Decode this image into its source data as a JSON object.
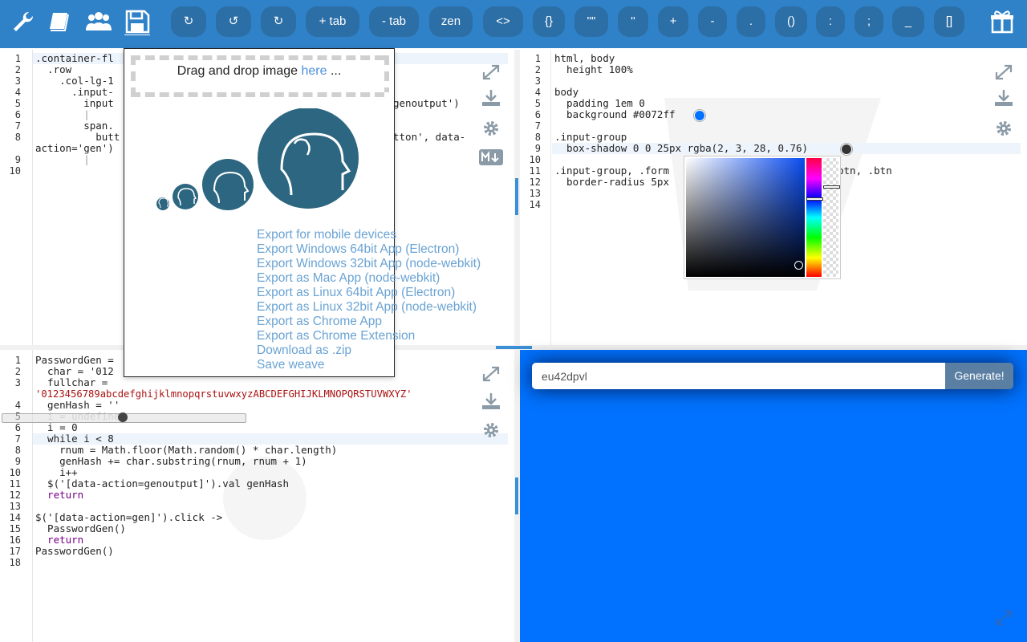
{
  "toolbar": {
    "buttons": [
      {
        "label": "↻",
        "name": "refresh-button"
      },
      {
        "label": "↺",
        "name": "undo-button"
      },
      {
        "label": "↻",
        "name": "redo-button"
      },
      {
        "label": "+ tab",
        "name": "add-tab-button"
      },
      {
        "label": "- tab",
        "name": "remove-tab-button"
      },
      {
        "label": "zen",
        "name": "zen-button"
      },
      {
        "label": "<>",
        "name": "insert-angle-brackets-button"
      },
      {
        "label": "{}",
        "name": "insert-braces-button"
      },
      {
        "label": "\"\"",
        "name": "insert-double-quotes-button"
      },
      {
        "label": "''",
        "name": "insert-single-quotes-button"
      },
      {
        "label": "+",
        "name": "insert-plus-button"
      },
      {
        "label": "-",
        "name": "insert-minus-button"
      },
      {
        "label": ".",
        "name": "insert-dot-button"
      },
      {
        "label": "()",
        "name": "insert-parens-button"
      },
      {
        "label": ":",
        "name": "insert-colon-button"
      },
      {
        "label": ";",
        "name": "insert-semicolon-button"
      },
      {
        "label": "_",
        "name": "insert-underscore-button"
      },
      {
        "label": "[]",
        "name": "insert-brackets-button"
      }
    ]
  },
  "popup": {
    "drop_text": "Drag and drop image ",
    "drop_link": "here",
    "drop_suffix": " ...",
    "exports": [
      "Export for mobile devices",
      "Export Windows 64bit App (Electron)",
      "Export Windows 32bit App (node-webkit)",
      "Export as Mac App (node-webkit)",
      "Export as Linux 64bit App (Electron)",
      "Export as Linux 32bit App (node-webkit)",
      "Export as Chrome App",
      "Export as Chrome Extension",
      "Download as .zip",
      "Save weave"
    ]
  },
  "html_pane": {
    "line_numbers": [
      "1",
      "2",
      "3",
      "4",
      "5",
      "6",
      "7",
      "8",
      "",
      "9",
      "10"
    ],
    "lines": [
      ".container-fl",
      "  .row",
      "    .col-lg-1",
      "      .input-",
      "        input",
      "        |",
      "        span.",
      "          butt",
      "action='gen')",
      "        |",
      ""
    ],
    "overflow_1": "genoutput')",
    "overflow_2": "tton', data-"
  },
  "css_pane": {
    "line_numbers": [
      "1",
      "2",
      "3",
      "4",
      "5",
      "6",
      "7",
      "8",
      "9",
      "10",
      "11",
      "12",
      "13",
      "14"
    ],
    "lines": [
      "html, body",
      "  height 100%",
      "",
      "body",
      "  padding 1em 0",
      "  background #0072ff",
      "",
      ".input-group",
      "  box-shadow 0 0 25px rgba(2, 3, 28, 0.76)",
      "",
      ".input-group, .form",
      "  border-radius 5px",
      "",
      ""
    ],
    "overflow_11": "btn, .btn",
    "colors": {
      "swatch_blue": "#0072ff",
      "swatch_dark": "#02031c"
    }
  },
  "js_pane": {
    "line_numbers": [
      "1",
      "2",
      "3",
      "",
      "4",
      "5",
      "6",
      "7",
      "8",
      "9",
      "10",
      "11",
      "12",
      "13",
      "14",
      "15",
      "16",
      "17",
      "18"
    ],
    "lines": [
      "PasswordGen =",
      "  char = '012",
      "  fullchar =",
      "'0123456789abcdefghijklmnopqrstuvwxyzABCDEFGHIJKLMNOPQRSTUVWXYZ'",
      "  genHash = ''",
      "  i = undefined",
      "  i = 0",
      "  while i < 8",
      "    rnum = Math.floor(Math.random() * char.length)",
      "    genHash += char.substring(rnum, rnum + 1)",
      "    i++",
      "  $('[data-action=genoutput]').val genHash",
      "  return",
      "",
      "$('[data-action=gen]').click ->",
      "  PasswordGen()",
      "  return",
      "PasswordGen()",
      ""
    ]
  },
  "preview": {
    "input_value": "eu42dpvl",
    "button_label": "Generate!",
    "bg_color": "#0072ff"
  }
}
